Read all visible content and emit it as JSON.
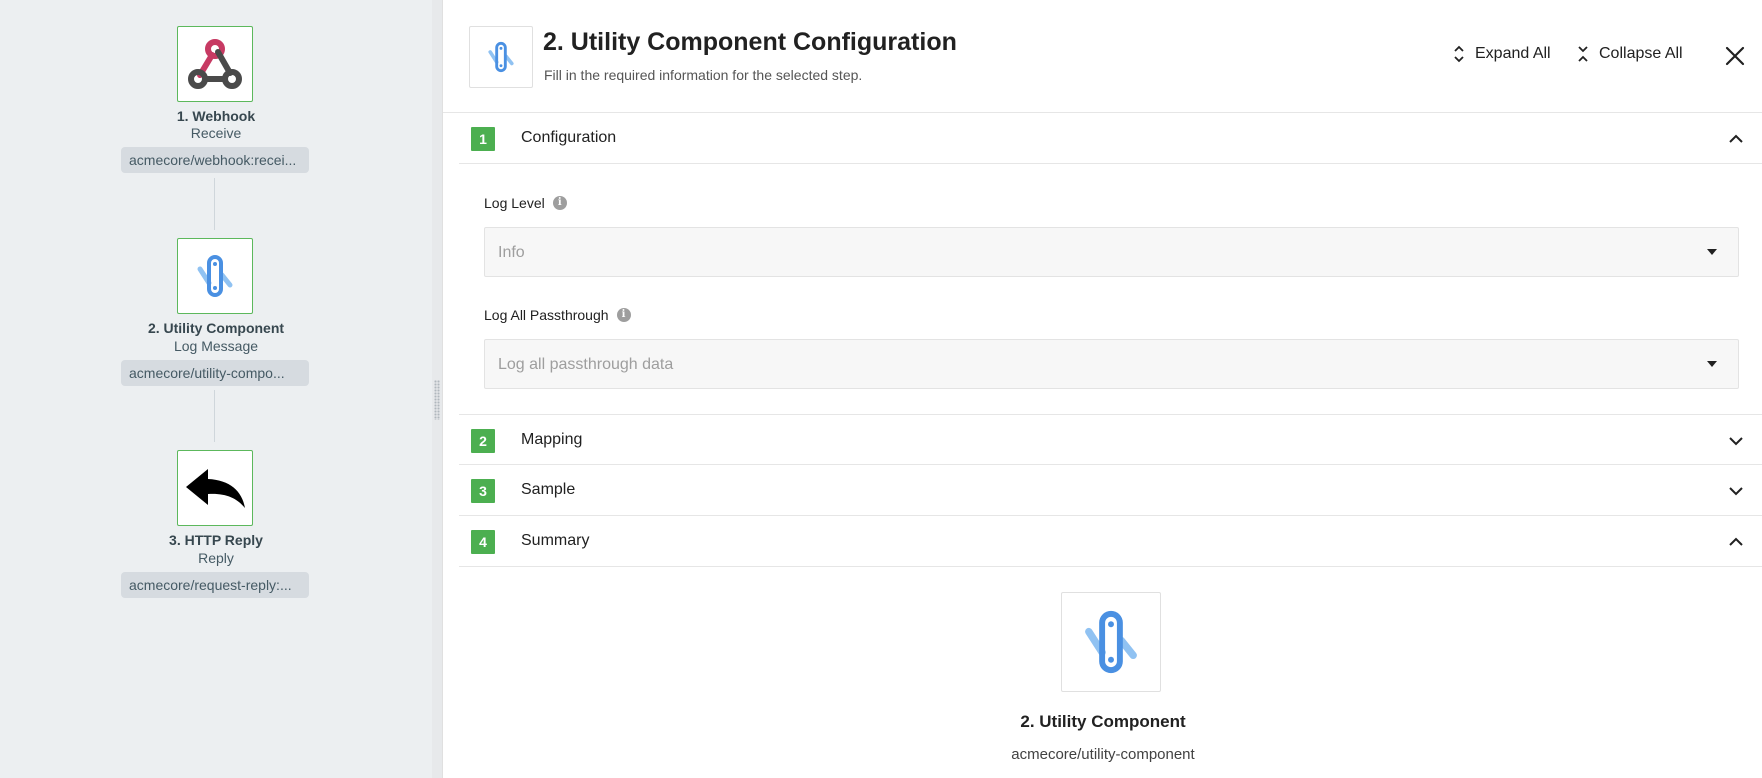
{
  "flow": {
    "steps": [
      {
        "title": "1. Webhook",
        "action": "Receive",
        "component": "acmecore/webhook:recei...",
        "icon": "webhook-icon"
      },
      {
        "title": "2. Utility Component",
        "action": "Log Message",
        "component": "acmecore/utility-compo...",
        "icon": "utility-component-icon"
      },
      {
        "title": "3. HTTP Reply",
        "action": "Reply",
        "component": "acmecore/request-reply:...",
        "icon": "reply-arrow-icon"
      }
    ]
  },
  "config": {
    "title": "2. Utility Component Configuration",
    "subtitle": "Fill in the required information for the selected step.",
    "expand_all": "Expand All",
    "collapse_all": "Collapse All",
    "sections": [
      {
        "num": "1",
        "label": "Configuration",
        "expanded": true
      },
      {
        "num": "2",
        "label": "Mapping",
        "expanded": false
      },
      {
        "num": "3",
        "label": "Sample",
        "expanded": false
      },
      {
        "num": "4",
        "label": "Summary",
        "expanded": true
      }
    ],
    "fields": {
      "log_level": {
        "label": "Log Level",
        "value": "Info"
      },
      "log_passthrough": {
        "label": "Log All Passthrough",
        "value": "Log all passthrough data"
      }
    },
    "summary": {
      "name": "2. Utility Component",
      "component": "acmecore/utility-component"
    }
  },
  "colors": {
    "accent_green": "#4caf50",
    "utility_blue": "#4a90e2",
    "webhook_pink": "#c73a63"
  }
}
